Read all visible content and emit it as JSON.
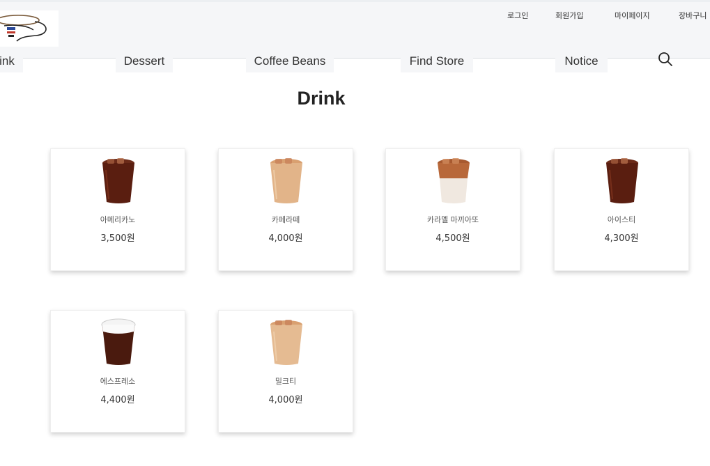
{
  "util_menu": {
    "login": "로그인",
    "signup": "회원가입",
    "mypage": "마이페이지",
    "cart": "장바구니"
  },
  "nav": {
    "items": [
      {
        "label": "Drink"
      },
      {
        "label": "Dessert"
      },
      {
        "label": "Coffee Beans"
      },
      {
        "label": "Find Store"
      },
      {
        "label": "Notice"
      }
    ]
  },
  "page": {
    "title": "Drink"
  },
  "products": [
    {
      "name": "아메리카노",
      "price": "3,500원",
      "icon": "americano-cup-icon"
    },
    {
      "name": "카페라떼",
      "price": "4,000원",
      "icon": "cafe-latte-cup-icon"
    },
    {
      "name": "카라멜 마끼아또",
      "price": "4,500원",
      "icon": "caramel-macchiato-cup-icon"
    },
    {
      "name": "아이스티",
      "price": "4,300원",
      "icon": "iced-tea-cup-icon"
    },
    {
      "name": "에스프레소",
      "price": "4,400원",
      "icon": "espresso-cup-icon"
    },
    {
      "name": "밀크티",
      "price": "4,000원",
      "icon": "milk-tea-cup-icon"
    }
  ],
  "colors": {
    "header_bg": "#f5f6f8",
    "dark_drink": "#5a1e10",
    "latte": "#e2b489",
    "ice": "#f0e8e0"
  }
}
